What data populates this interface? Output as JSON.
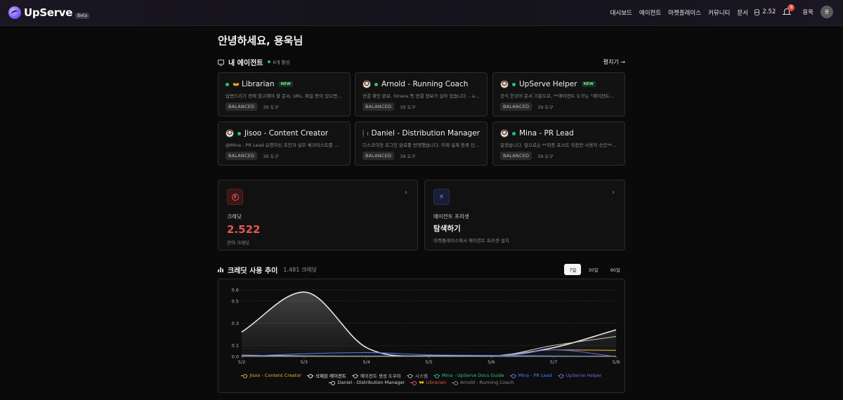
{
  "nav": {
    "logo_text": "UpServe",
    "beta_label": "Beta",
    "links": [
      "대시보드",
      "에이전트",
      "마켓플레이스",
      "커뮤니티",
      "문서"
    ],
    "credits": "2.52",
    "notification_count": "9",
    "user_name": "용욱",
    "avatar_initial": "용"
  },
  "greeting": "안녕하세요, 용욱님",
  "agents_section": {
    "title": "내 에이전트",
    "active_count": "6개 활성",
    "expand_label": "펼치기 →"
  },
  "agents": [
    {
      "emoji": "👐",
      "avatar": false,
      "name": "Librarian",
      "is_new": true,
      "new_label": "NEW",
      "desc": "답변드리기 전에 참고해야 할 문서, URL, 파일 등이 있으면 …",
      "mode": "BALANCED",
      "tools": "39 도구"
    },
    {
      "emoji": "",
      "avatar": true,
      "name": "Arnold - Running Coach",
      "is_new": false,
      "new_label": "",
      "desc": "연결 확인 완료. Strava 쪽 연결 정보가 살아 있습니다. - ath…",
      "mode": "BALANCED",
      "tools": "39 도구"
    },
    {
      "emoji": "",
      "avatar": true,
      "name": "UpServe Helper",
      "is_new": true,
      "new_label": "NEW",
      "desc": "공식 한국어 문서 기준으로, **에이전트 도구는 \"에이전트에…",
      "mode": "BALANCED",
      "tools": "39 도구"
    },
    {
      "emoji": "",
      "avatar": true,
      "name": "Jisoo - Content Creator",
      "is_new": false,
      "new_label": "",
      "desc": "@Mina - PR Lead 요청하신 초안과 실무 체크리스트를 정…",
      "mode": "BALANCED",
      "tools": "39 도구"
    },
    {
      "emoji": "",
      "avatar": true,
      "name": "Daniel - Distribution Manager",
      "is_new": false,
      "new_label": "",
      "desc": "디스코이엇 로그인 완료를 반영했습니다. 이제 실제 등록 단…",
      "mode": "BALANCED",
      "tools": "39 도구"
    },
    {
      "emoji": "",
      "avatar": true,
      "name": "Mina - PR Lead",
      "is_new": false,
      "new_label": "",
      "desc": "알겠습니다. 앞으로는 **최종 포스트 직전만 사용자 승인**…",
      "mode": "BALANCED",
      "tools": "39 도구"
    }
  ],
  "credit_card": {
    "label": "크레딧",
    "value": "2.522",
    "sub": "잔여 크레딧"
  },
  "preset_card": {
    "label": "에이전트 프리셋",
    "value": "탐색하기",
    "sub": "마켓플레이스에서 에이전트 프리셋 설치"
  },
  "usage": {
    "title": "크레딧 사용 추이",
    "total": "1.481 크레딧",
    "ranges": [
      "7일",
      "30일",
      "90일"
    ],
    "active_range": "7일"
  },
  "chart_data": {
    "type": "area",
    "title": "",
    "xlabel": "",
    "ylabel": "",
    "x": [
      "5/2",
      "5/3",
      "5/4",
      "5/5",
      "5/6",
      "5/7",
      "5/8"
    ],
    "yticks": [
      0.0,
      0.1,
      0.3,
      0.5,
      0.6
    ],
    "ylim": [
      0,
      0.6
    ],
    "grid": true,
    "legend_position": "bottom",
    "series": [
      {
        "name": "Jisoo - Content Creator",
        "color": "#e8b23a",
        "values": [
          0.002,
          0.003,
          0.002,
          0.003,
          0.004,
          0.06,
          0.055
        ]
      },
      {
        "name": "삭제된 에이전트",
        "color": "#f2f2f2",
        "values": [
          0.22,
          0.58,
          0.08,
          0.005,
          0.005,
          0.08,
          0.24
        ]
      },
      {
        "name": "에이전트 생성 도우미",
        "color": "#cfcfcf",
        "values": [
          0.012,
          0.005,
          0.004,
          0.004,
          0.004,
          0.1,
          0.18
        ]
      },
      {
        "name": "시스템",
        "color": "#b0b0b0",
        "values": [
          0.003,
          0.002,
          0.002,
          0.003,
          0.003,
          0.003,
          0.004
        ]
      },
      {
        "name": "Mina - UpServe Docs Guide",
        "color": "#33c08a",
        "values": [
          0.0,
          0.0,
          0.0,
          0.0,
          0.0,
          0.0,
          0.0
        ]
      },
      {
        "name": "Mina - PR Lead",
        "color": "#4a82ff",
        "values": [
          0.0,
          0.025,
          0.035,
          0.015,
          0.01,
          0.005,
          0.0
        ]
      },
      {
        "name": "UpServe Helper",
        "color": "#6a6fe8",
        "values": [
          0.0,
          0.0,
          0.0,
          0.0,
          0.0,
          0.06,
          0.0
        ]
      },
      {
        "name": "Daniel - Distribution Manager",
        "color": "#d8d8d8",
        "values": [
          0.0,
          0.0,
          0.0,
          0.0,
          0.0,
          0.0,
          0.0
        ]
      },
      {
        "name": "👐 Librarian",
        "color": "#e85a4f",
        "values": [
          0.0,
          0.0,
          0.0,
          0.0,
          0.0,
          0.0,
          0.0
        ]
      },
      {
        "name": "Arnold - Running Coach",
        "color": "#8a8a8a",
        "values": [
          0.0,
          0.0,
          0.0,
          0.0,
          0.0,
          0.0,
          0.0
        ]
      }
    ]
  }
}
